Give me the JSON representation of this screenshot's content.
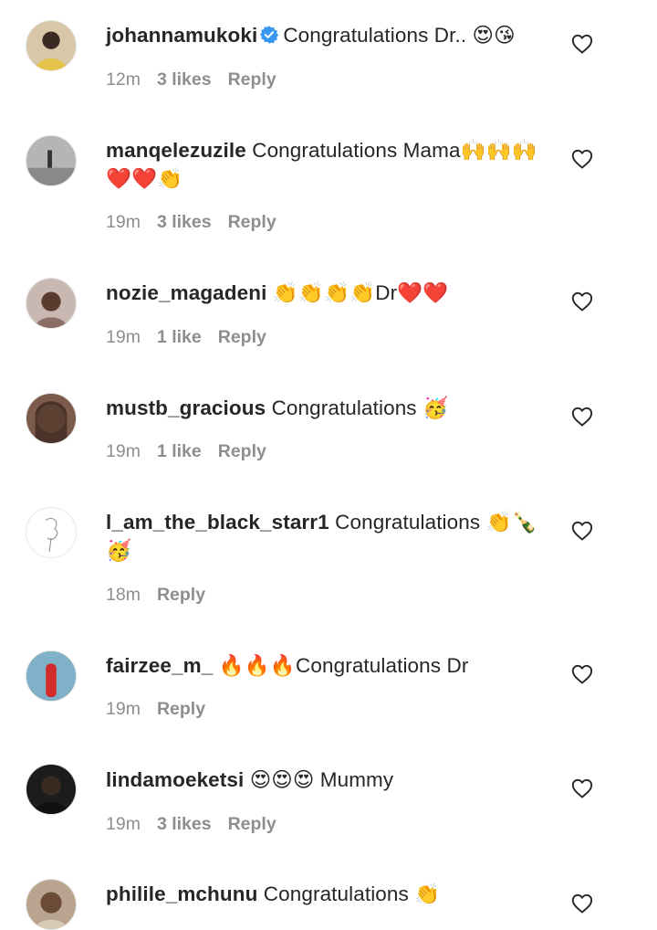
{
  "comments": [
    {
      "username": "johannamukoki",
      "verified": true,
      "text": "Congratulations Dr.. 😍😘",
      "time": "12m",
      "likes": "3 likes",
      "reply": "Reply",
      "avatar_icon": "avatar-woman-yellow-dress",
      "avatar_bg": "#d8c7a8"
    },
    {
      "username": "manqelezuzile",
      "verified": false,
      "text": "Congratulations Mama🙌🙌🙌❤️❤️👏",
      "time": "19m",
      "likes": "3 likes",
      "reply": "Reply",
      "avatar_icon": "avatar-beach-grayscale",
      "avatar_bg": "#9a9a9a"
    },
    {
      "username": "nozie_magadeni",
      "verified": false,
      "text": "👏👏👏👏Dr❤️❤️",
      "time": "19m",
      "likes": "1 like",
      "reply": "Reply",
      "avatar_icon": "avatar-woman-braids",
      "avatar_bg": "#c9b7b1"
    },
    {
      "username": "mustb_gracious",
      "verified": false,
      "text": "Congratulations 🥳",
      "time": "19m",
      "likes": "1 like",
      "reply": "Reply",
      "avatar_icon": "avatar-woman-closeup",
      "avatar_bg": "#7c5a4c"
    },
    {
      "username": "l_am_the_black_starr1",
      "verified": false,
      "text": "Congratulations 👏🍾🥳",
      "time": "18m",
      "likes": "",
      "reply": "Reply",
      "avatar_icon": "avatar-rose-sketch",
      "avatar_bg": "#ffffff"
    },
    {
      "username": "fairzee_m_",
      "verified": false,
      "text": "🔥🔥🔥Congratulations Dr",
      "time": "19m",
      "likes": "",
      "reply": "Reply",
      "avatar_icon": "avatar-person-red-outfit",
      "avatar_bg": "#5c8a9e"
    },
    {
      "username": "lindamoeketsi",
      "verified": false,
      "text": "😍😍😍 Mummy",
      "time": "19m",
      "likes": "3 likes",
      "reply": "Reply",
      "avatar_icon": "avatar-man-dark",
      "avatar_bg": "#1c1c1c"
    },
    {
      "username": "philile_mchunu",
      "verified": false,
      "text": "Congratulations 👏",
      "time": "",
      "likes": "",
      "reply": "",
      "avatar_icon": "avatar-woman-smiling",
      "avatar_bg": "#b9a58f"
    }
  ],
  "icons": {
    "like": "heart-outline-icon",
    "verified": "verified-badge-icon"
  },
  "colors": {
    "text": "#262626",
    "meta": "#8e8e8e",
    "verified": "#3897f0",
    "heart": "#262626"
  }
}
